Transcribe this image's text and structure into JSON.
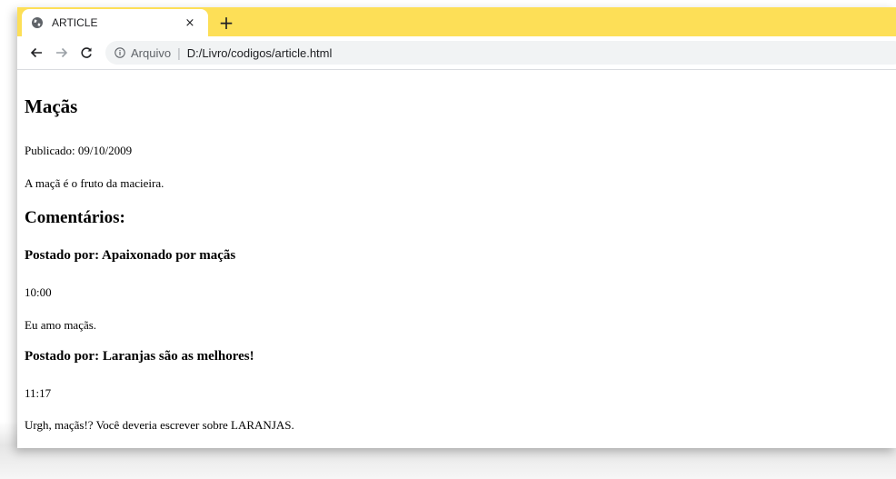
{
  "browser": {
    "tab_title": "ARTICLE",
    "tab_close": "×",
    "new_tab": "+",
    "nav": {
      "back": "←",
      "forward": "→",
      "reload": "C"
    },
    "omnibox": {
      "scheme_label": "Arquivo",
      "separator": "|",
      "url": "D:/Livro/codigos/article.html"
    },
    "colors": {
      "tabstrip": "#fddf57",
      "omnibox": "#f1f3f4"
    }
  },
  "article": {
    "title": "Maçãs",
    "published": "Publicado: 09/10/2009",
    "body": "A maçã é o fruto da macieira.",
    "comments_heading": "Comentários:",
    "comments": [
      {
        "author": "Postado por: Apaixonado por maçãs",
        "time": "10:00",
        "text": "Eu amo maçãs."
      },
      {
        "author": "Postado por: Laranjas são as melhores!",
        "time": "11:17",
        "text": "Urgh, maçãs!? Você deveria escrever sobre LARANJAS."
      }
    ]
  }
}
